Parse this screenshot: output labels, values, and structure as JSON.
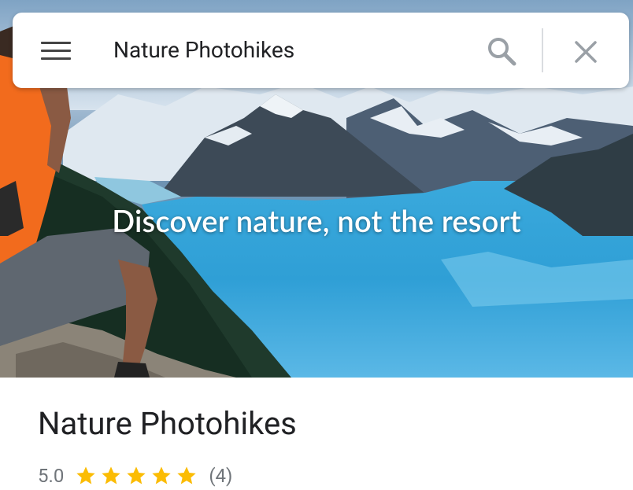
{
  "search": {
    "query": "Nature Photohikes"
  },
  "hero": {
    "tagline": "Discover nature, not the resort"
  },
  "place": {
    "title": "Nature Photohikes",
    "rating": "5.0",
    "rating_stars": 5,
    "review_count": "(4)"
  },
  "colors": {
    "star": "#fbbc04",
    "secondary_text": "#70757a",
    "primary_text": "#202124",
    "lake": "#2f9fd6"
  },
  "icons": {
    "menu": "hamburger-menu-icon",
    "search": "search-icon",
    "close": "close-icon",
    "star": "star-icon"
  }
}
